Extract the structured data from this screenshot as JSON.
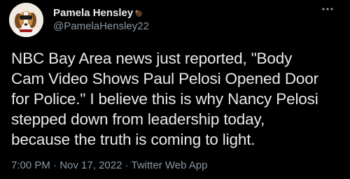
{
  "author": {
    "display_name": "Pamela Hensley",
    "handle": "@PamelaHensley22",
    "avatar_icon": "dog-avatar",
    "name_emoji_icon": "turkey-emoji-icon"
  },
  "more_icon": "more-horizontal-icon",
  "tweet": {
    "lines": [
      "NBC Bay Area news just reported, \"Body",
      "Cam Video Shows Paul Pelosi Opened Door",
      "for Police.\" I believe this is why Nancy Pelosi",
      "stepped down from leadership today,",
      "because the truth is coming to light."
    ]
  },
  "meta": {
    "time": "7:00 PM",
    "separator": " · ",
    "date": "Nov 17, 2022",
    "source": "Twitter Web App"
  },
  "colors": {
    "background": "#000000",
    "text": "#e7e9ea",
    "secondary": "#8b98a5"
  }
}
